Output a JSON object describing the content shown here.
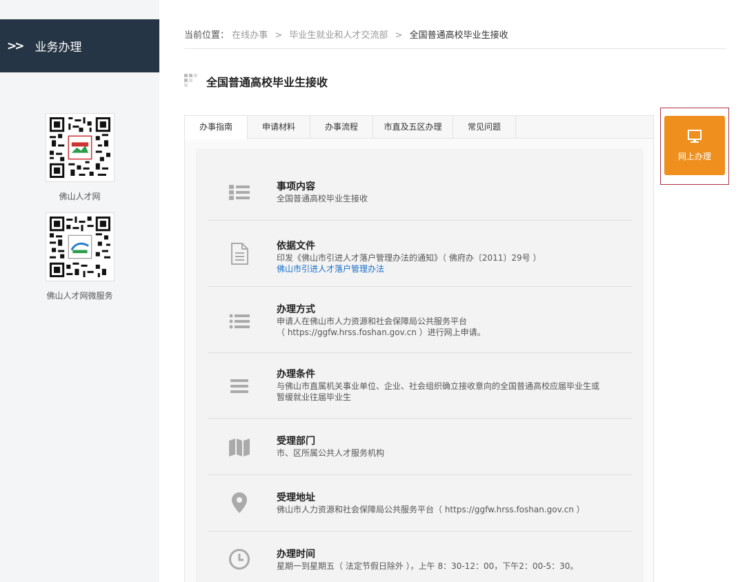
{
  "sidebar": {
    "title": "业务办理",
    "qr_codes": [
      {
        "label": "佛山人才网"
      },
      {
        "label": "佛山人才网微服务"
      }
    ]
  },
  "breadcrumb": {
    "prefix": "当前位置：",
    "items": [
      "在线办事",
      "毕业生就业和人才交流部"
    ],
    "current": "全国普通高校毕业生接收",
    "separator": ">"
  },
  "page": {
    "title": "全国普通高校毕业生接收"
  },
  "tabs": [
    {
      "label": "办事指南"
    },
    {
      "label": "申请材料"
    },
    {
      "label": "办事流程"
    },
    {
      "label": "市直及五区办理"
    },
    {
      "label": "常见问题"
    }
  ],
  "items": [
    {
      "icon": "list-icon",
      "title": "事项内容",
      "lines": [
        "全国普通高校毕业生接收"
      ]
    },
    {
      "icon": "document-icon",
      "title": "依据文件",
      "lines": [
        "印发《佛山市引进人才落户管理办法的通知》（ 佛府办〔2011〕29号 ）"
      ],
      "link": "佛山市引进人才落户管理办法"
    },
    {
      "icon": "bullet-list-icon",
      "title": "办理方式",
      "lines": [
        "申请人在佛山市人力资源和社会保障局公共服务平台",
        "（ https://ggfw.hrss.foshan.gov.cn ）进行网上申请。"
      ]
    },
    {
      "icon": "menu-icon",
      "title": "办理条件",
      "lines": [
        "与佛山市直属机关事业单位、企业、社会组织确立接收意向的全国普通高校应届毕业生或",
        "暂缓就业往届毕业生"
      ]
    },
    {
      "icon": "map-icon",
      "title": "受理部门",
      "lines": [
        "市、区所属公共人才服务机构"
      ]
    },
    {
      "icon": "location-pin-icon",
      "title": "受理地址",
      "lines": [
        "佛山市人力资源和社会保障局公共服务平台（ https://ggfw.hrss.foshan.gov.cn ）"
      ]
    },
    {
      "icon": "clock-icon",
      "title": "办理时间",
      "lines": [
        "星期一到星期五（ 法定节假日除外 ），上午 8：30-12：00，下午2：00-5：30。"
      ]
    }
  ],
  "online_button": {
    "label": "网上办理"
  },
  "colors": {
    "sidebar_header": "#263545",
    "accent_orange": "#ee8f1e",
    "link_blue": "#1a6fc9"
  }
}
